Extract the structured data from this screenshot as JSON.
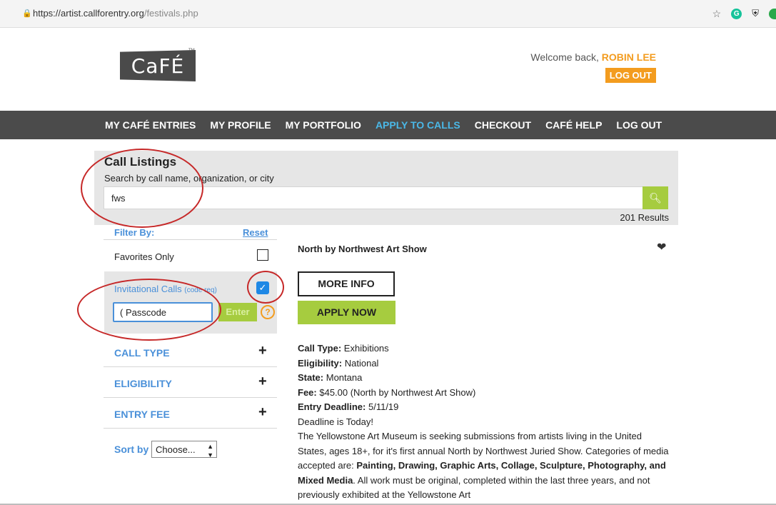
{
  "browser": {
    "url_host": "https://artist.callforentry.org",
    "url_path": "/festivals.php",
    "icons": [
      "lock-icon",
      "star-icon",
      "grammarly-icon",
      "shield-extension-icon",
      "extension-icon"
    ]
  },
  "header": {
    "logo_text": "CaFÉ",
    "logo_tm": "TM",
    "welcome_prefix": "Welcome back, ",
    "user_name": "ROBIN LEE",
    "logout_label": "LOG OUT"
  },
  "nav": {
    "items": [
      {
        "label": "MY CAFÉ ENTRIES"
      },
      {
        "label": "MY PROFILE"
      },
      {
        "label": "MY PORTFOLIO"
      },
      {
        "label": "APPLY TO CALLS",
        "active": true
      },
      {
        "label": "CHECKOUT"
      },
      {
        "label": "CAFÉ HELP"
      },
      {
        "label": "LOG OUT"
      }
    ]
  },
  "search": {
    "title": "Call Listings",
    "subtitle": "Search by call name, organization, or city",
    "value": "fws",
    "results": "201 Results"
  },
  "filters": {
    "heading": "Filter By:",
    "reset_label": "Reset",
    "favorites_label": "Favorites Only",
    "favorites_checked": false,
    "invitational_label": "Invitational Calls",
    "invitational_note": "(code req)",
    "invitational_checked": true,
    "passcode_value": "(",
    "passcode_placeholder": "Passcode",
    "enter_label": "Enter",
    "help_symbol": "?",
    "sections": [
      "CALL TYPE",
      "ELIGIBILITY",
      "ENTRY FEE"
    ],
    "sort_label": "Sort by",
    "sort_value": "Choose..."
  },
  "listing": {
    "title": "North by Northwest Art Show",
    "more_info_label": "MORE INFO",
    "apply_label": "APPLY NOW",
    "call_type_label": "Call Type:",
    "call_type": "Exhibitions",
    "eligibility_label": "Eligibility:",
    "eligibility": "National",
    "state_label": "State:",
    "state": "Montana",
    "fee_label": "Fee:",
    "fee": "$45.00 (North by Northwest Art Show)",
    "deadline_label": "Entry Deadline:",
    "deadline": "5/11/19",
    "deadline_note": "Deadline is Today!",
    "desc_1": "The Yellowstone Art Museum is seeking submissions from artists living in the United States, ages 18+, for it's first annual North by Northwest Juried Show. Categories of media accepted are: ",
    "desc_media": "Painting, Drawing, Graphic Arts, Collage, Sculpture, Photography, and Mixed Media",
    "desc_2": ". All work must be original, completed within the last three years, and not previously exhibited at the Yellowstone Art"
  },
  "colors": {
    "accent_orange": "#f39c1f",
    "nav_bg": "#4b4b4b",
    "active_blue": "#4ab8e8",
    "link_blue": "#4a90d9",
    "button_green": "#a6cc3f",
    "annotation_red": "#c62828"
  }
}
